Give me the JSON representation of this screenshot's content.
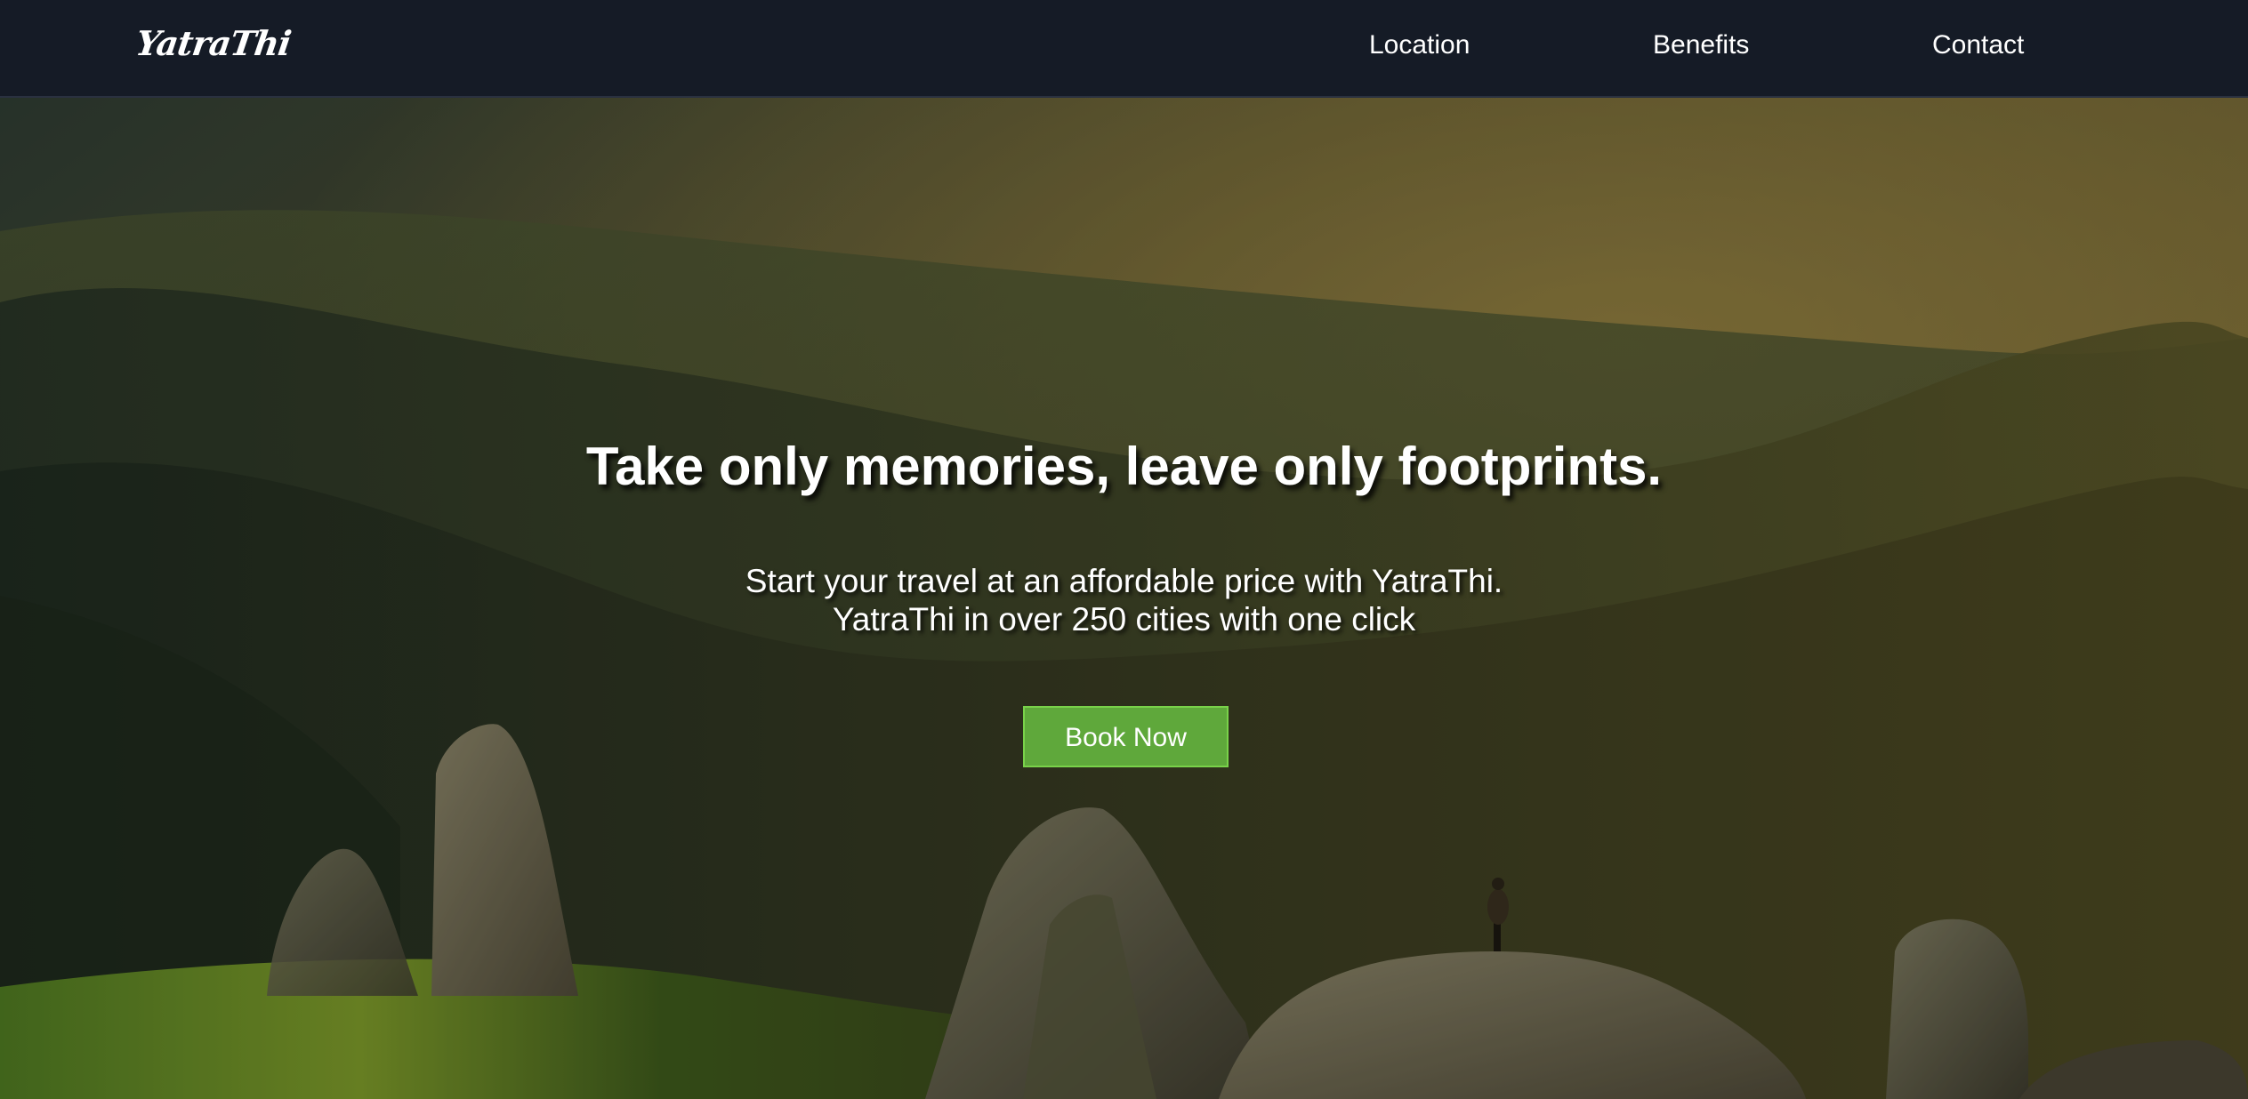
{
  "nav": {
    "logo": "YatraThi",
    "links": [
      "Location",
      "Benefits",
      "Contact"
    ]
  },
  "hero": {
    "title": "Take only memories, leave only footprints.",
    "subtitle_line1": "Start your travel at an affordable price with YatraThi.",
    "subtitle_line2": "YatraThi in over 250 cities with one click",
    "cta": "Book Now"
  },
  "colors": {
    "navbar_bg": "#151b26",
    "cta_bg": "#5fa83b",
    "cta_border": "#79d24a",
    "text": "#ffffff"
  }
}
